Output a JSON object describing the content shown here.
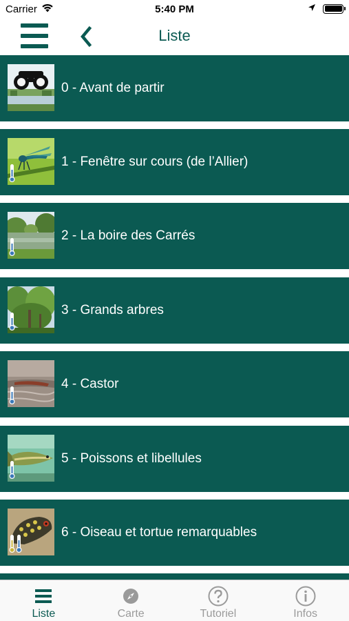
{
  "status_bar": {
    "carrier": "Carrier",
    "time": "5:40 PM",
    "battery_level": 1.0
  },
  "nav": {
    "title": "Liste",
    "menu_icon": "hamburger-menu-icon",
    "back_icon": "chevron-left-icon"
  },
  "colors": {
    "primary": "#0b5a52",
    "tab_inactive": "#9a9a9a",
    "background": "#ffffff"
  },
  "list": {
    "items": [
      {
        "label": "0 - Avant de partir",
        "thumbnail": "binoculars-landscape",
        "thermometers": 0
      },
      {
        "label": "1 - Fenêtre sur cours (de l’Allier)",
        "thumbnail": "damselfly",
        "thermometers": 1
      },
      {
        "label": "2 - La boire des Carrés",
        "thumbnail": "pond",
        "thermometers": 1
      },
      {
        "label": "3 - Grands arbres",
        "thumbnail": "trees",
        "thermometers": 1
      },
      {
        "label": "4 - Castor",
        "thumbnail": "beaver-water",
        "thermometers": 1
      },
      {
        "label": "5 - Poissons et libellules",
        "thumbnail": "pike-fish",
        "thermometers": 1
      },
      {
        "label": "6 - Oiseau et tortue remarquables",
        "thumbnail": "turtle",
        "thermometers": 2
      }
    ]
  },
  "tabs": [
    {
      "label": "Liste",
      "icon": "list-icon",
      "active": true
    },
    {
      "label": "Carte",
      "icon": "compass-icon",
      "active": false
    },
    {
      "label": "Tutoriel",
      "icon": "question-circle-icon",
      "active": false
    },
    {
      "label": "Infos",
      "icon": "info-circle-icon",
      "active": false
    }
  ]
}
